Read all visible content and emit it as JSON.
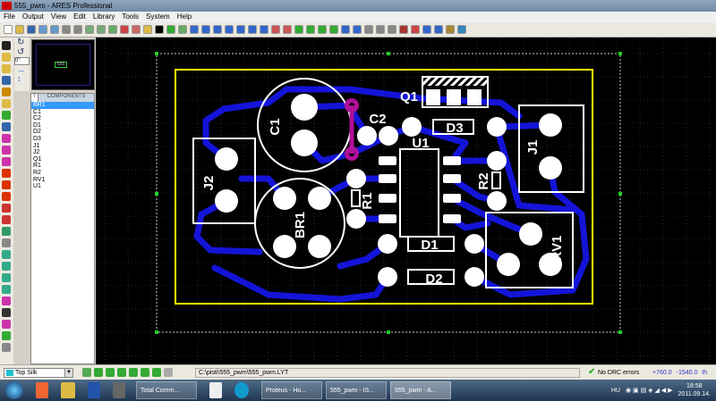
{
  "window": {
    "title": "555_pwm - ARES Professional",
    "logo": "ARES"
  },
  "menu": [
    "File",
    "Output",
    "View",
    "Edit",
    "Library",
    "Tools",
    "System",
    "Help"
  ],
  "rotation": {
    "angle": "0°"
  },
  "overview": {
    "label": "555"
  },
  "components": {
    "header": "COMPONENTS",
    "tab": "T",
    "items": [
      "BR1",
      "C1",
      "C2",
      "D1",
      "D2",
      "D3",
      "J1",
      "J2",
      "Q1",
      "R1",
      "R2",
      "RV1",
      "U1"
    ],
    "selected": "BR1"
  },
  "pcb": {
    "labels": {
      "C1": "C1",
      "C2": "C2",
      "Q1": "Q1",
      "U1": "U1",
      "D3": "D3",
      "J1": "J1",
      "J2": "J2",
      "R1": "R1",
      "R2": "R2",
      "BR1": "BR1",
      "D1": "D1",
      "D2": "D2",
      "RV1": "RV1"
    },
    "colors": {
      "board_outline": "#ffff00",
      "track": "#1414d8",
      "silk": "#ffffff",
      "via": "#b0109a",
      "background": "#000000"
    }
  },
  "status": {
    "layer": "Top Silk",
    "path": "C:\\pisti\\555_pwm\\555_pwm.LYT",
    "drc": "No DRC errors",
    "x": "+760.0",
    "y": "-1540.0",
    "unit": "th"
  },
  "taskbar": {
    "tasks": [
      "Total Comm...",
      "Proteus - Ho...",
      "555_pwm - IS...",
      "555_pwm - A..."
    ],
    "lang": "HU",
    "time": "18:58",
    "date": "2011.09.14."
  }
}
